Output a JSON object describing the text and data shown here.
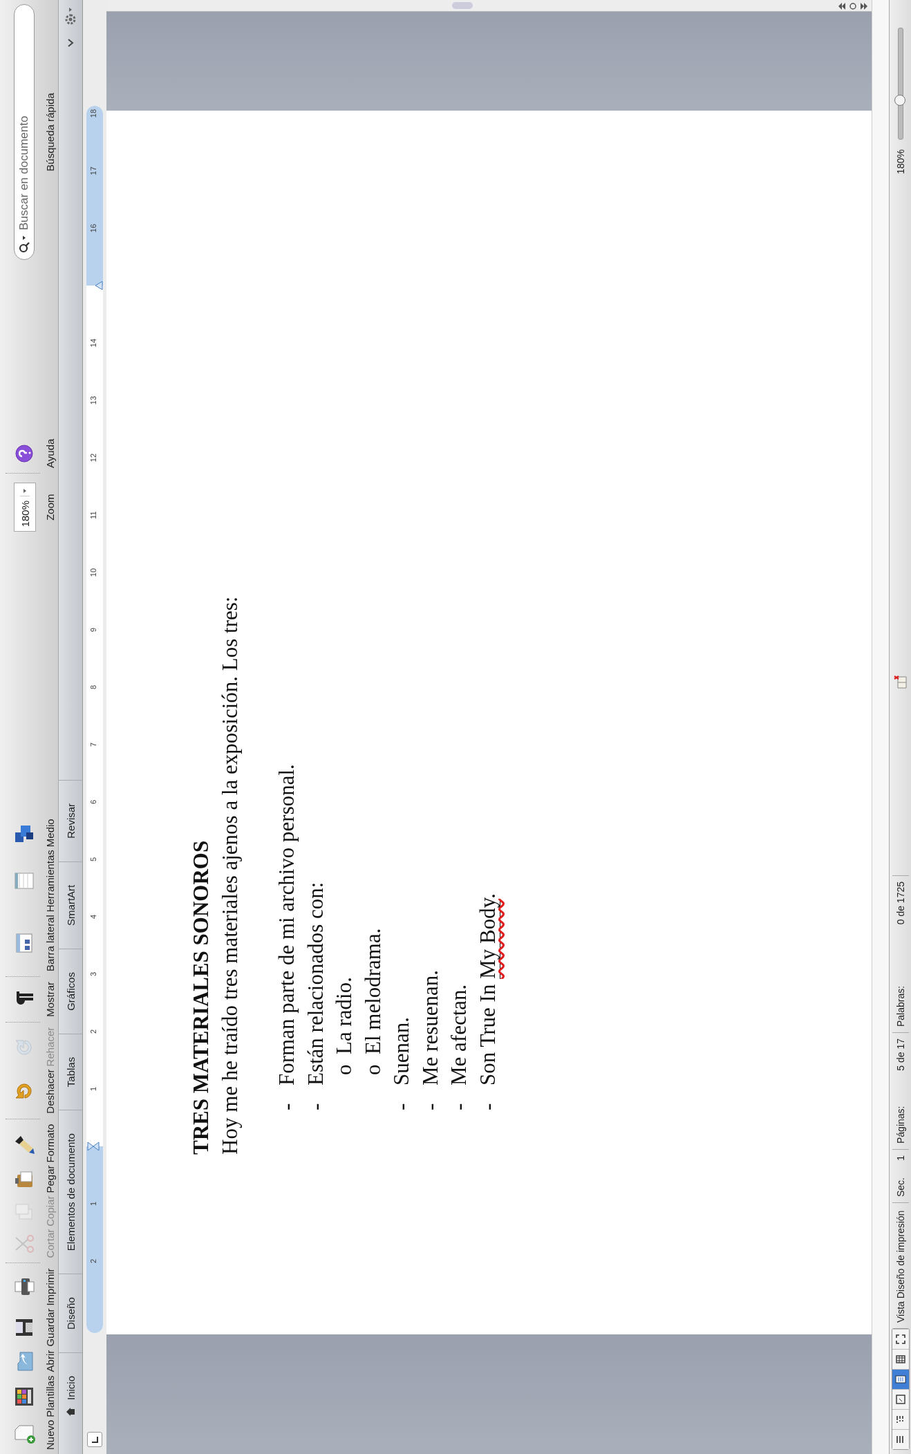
{
  "toolbar": {
    "groups": [
      [
        {
          "kind": "new",
          "label": "Nuevo",
          "disabled": false
        },
        {
          "kind": "templates",
          "label": "Plantillas",
          "disabled": false
        },
        {
          "kind": "open",
          "label": "Abrir",
          "disabled": false
        },
        {
          "kind": "save",
          "label": "Guardar",
          "disabled": false
        },
        {
          "kind": "print",
          "label": "Imprimir",
          "disabled": false
        }
      ],
      [
        {
          "kind": "cut",
          "label": "Cortar",
          "disabled": true
        },
        {
          "kind": "copy",
          "label": "Copiar",
          "disabled": true
        },
        {
          "kind": "paste",
          "label": "Pegar",
          "disabled": false
        },
        {
          "kind": "format",
          "label": "Formato",
          "disabled": false
        }
      ],
      [
        {
          "kind": "undo",
          "label": "Deshacer",
          "disabled": false
        },
        {
          "kind": "redo",
          "label": "Rehacer",
          "disabled": true
        }
      ],
      [
        {
          "kind": "show",
          "label": "Mostrar",
          "disabled": false
        }
      ],
      [
        {
          "kind": "sidebar",
          "label": "Barra lateral",
          "disabled": false
        },
        {
          "kind": "toolbox",
          "label": "Herramientas",
          "disabled": false
        },
        {
          "kind": "media",
          "label": "Medio",
          "disabled": false
        }
      ]
    ],
    "zoom": {
      "value": "180%",
      "label": "Zoom"
    },
    "help": {
      "label": "Ayuda"
    },
    "search": {
      "placeholder": "Buscar en documento",
      "label": "Búsqueda rápida"
    }
  },
  "ribbon_tabs": [
    {
      "label": "Inicio",
      "selected": false
    },
    {
      "label": "Diseño",
      "selected": false
    },
    {
      "label": "Elementos de documento",
      "selected": false
    },
    {
      "label": "Tablas",
      "selected": false
    },
    {
      "label": "Gráficos",
      "selected": false
    },
    {
      "label": "SmartArt",
      "selected": false
    },
    {
      "label": "Revisar",
      "selected": false
    }
  ],
  "ruler": {
    "left_margin_labels": [
      "2",
      "1"
    ],
    "body_labels": [
      "1",
      "2",
      "3",
      "4",
      "5",
      "6",
      "7",
      "8",
      "9",
      "10",
      "11",
      "12",
      "13",
      "14"
    ],
    "right_margin_labels": [
      "16",
      "17",
      "18"
    ]
  },
  "document": {
    "title": "TRES MATERIALES SONOROS",
    "intro": "Hoy me he traído tres materiales ajenos a la exposición. Los tres:",
    "items": [
      {
        "marker": "-",
        "segments": [
          {
            "text": "Forman parte de mi archivo personal."
          }
        ]
      },
      {
        "marker": "-",
        "segments": [
          {
            "text": "Están relacionados con:"
          }
        ],
        "children": [
          {
            "marker": "o",
            "segments": [
              {
                "text": "La radio."
              }
            ]
          },
          {
            "marker": "o",
            "segments": [
              {
                "text": "El melodrama."
              }
            ]
          }
        ]
      },
      {
        "marker": "-",
        "segments": [
          {
            "text": "Suenan."
          }
        ]
      },
      {
        "marker": "-",
        "segments": [
          {
            "text": "Me resuenan."
          }
        ]
      },
      {
        "marker": "-",
        "segments": [
          {
            "text": "Me afectan."
          }
        ]
      },
      {
        "marker": "-",
        "segments": [
          {
            "text": "Son True In ",
            "underlined": false,
            "misspelled": false
          },
          {
            "text": "My Body",
            "underlined": true,
            "misspelled": true
          },
          {
            "text": ".",
            "underlined": false,
            "misspelled": false
          }
        ]
      }
    ]
  },
  "status_bar": {
    "view_buttons": [
      {
        "kind": "draft",
        "selected": false
      },
      {
        "kind": "outline",
        "selected": false
      },
      {
        "kind": "publishing",
        "selected": false
      },
      {
        "kind": "print",
        "selected": true
      },
      {
        "kind": "notebook",
        "selected": false
      },
      {
        "kind": "focus",
        "selected": false
      }
    ],
    "view_name": "Vista Diseño de impresión",
    "section_label": "Sec.",
    "section": "1",
    "pages_label": "Páginas:",
    "pages": "5 de 17",
    "words_label": "Palabras:",
    "words": "0 de 1725",
    "zoom_value": "180%",
    "zoom_slider": {
      "level": 0.35
    }
  }
}
